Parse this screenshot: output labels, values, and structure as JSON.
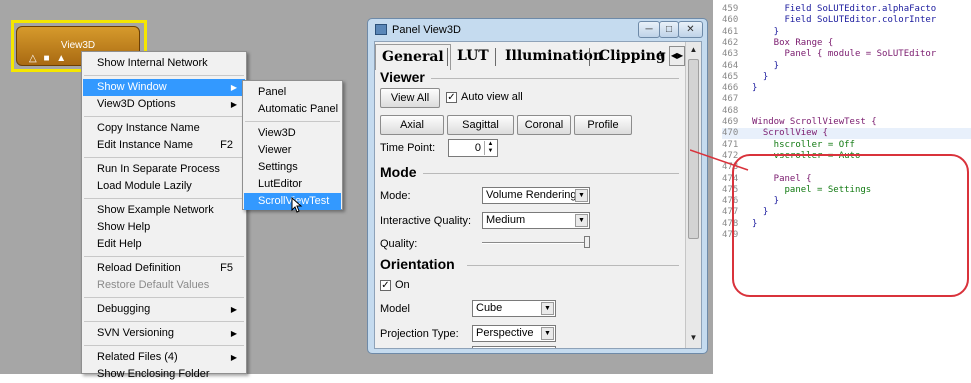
{
  "module": {
    "label": "View3D",
    "ports": "△ ■ ▲"
  },
  "menu": {
    "items": [
      {
        "label": "Show Internal Network",
        "shortcut": "",
        "arrow": false,
        "disabled": false,
        "highlighted": false
      },
      {
        "label": "Show Window",
        "shortcut": "",
        "arrow": true,
        "disabled": false,
        "highlighted": true
      },
      {
        "label": "View3D Options",
        "shortcut": "",
        "arrow": true,
        "disabled": false,
        "highlighted": false
      },
      {
        "label": "Copy Instance Name",
        "shortcut": "",
        "arrow": false,
        "disabled": false,
        "highlighted": false
      },
      {
        "label": "Edit Instance Name",
        "shortcut": "F2",
        "arrow": false,
        "disabled": false,
        "highlighted": false
      },
      {
        "label": "Run In Separate Process",
        "shortcut": "",
        "arrow": false,
        "disabled": false,
        "highlighted": false
      },
      {
        "label": "Load Module Lazily",
        "shortcut": "",
        "arrow": false,
        "disabled": false,
        "highlighted": false
      },
      {
        "label": "Show Example Network",
        "shortcut": "",
        "arrow": false,
        "disabled": false,
        "highlighted": false
      },
      {
        "label": "Show Help",
        "shortcut": "",
        "arrow": false,
        "disabled": false,
        "highlighted": false
      },
      {
        "label": "Edit Help",
        "shortcut": "",
        "arrow": false,
        "disabled": false,
        "highlighted": false
      },
      {
        "label": "Reload Definition",
        "shortcut": "F5",
        "arrow": false,
        "disabled": false,
        "highlighted": false
      },
      {
        "label": "Restore Default Values",
        "shortcut": "",
        "arrow": false,
        "disabled": true,
        "highlighted": false
      },
      {
        "label": "Debugging",
        "shortcut": "",
        "arrow": true,
        "disabled": false,
        "highlighted": false
      },
      {
        "label": "SVN Versioning",
        "shortcut": "",
        "arrow": true,
        "disabled": false,
        "highlighted": false
      },
      {
        "label": "Related Files (4)",
        "shortcut": "",
        "arrow": true,
        "disabled": false,
        "highlighted": false
      },
      {
        "label": "Show Enclosing Folder",
        "shortcut": "",
        "arrow": false,
        "disabled": false,
        "highlighted": false
      }
    ]
  },
  "submenu": {
    "items": [
      {
        "label": "Panel",
        "highlighted": false
      },
      {
        "label": "Automatic Panel",
        "highlighted": false
      },
      {
        "label": "View3D",
        "highlighted": false
      },
      {
        "label": "Viewer",
        "highlighted": false
      },
      {
        "label": "Settings",
        "highlighted": false
      },
      {
        "label": "LutEditor",
        "highlighted": false
      },
      {
        "label": "ScrollViewTest",
        "highlighted": true
      }
    ]
  },
  "panel": {
    "title": "Panel View3D",
    "tabs": [
      "General",
      "LUT",
      "Illumination",
      "Clipping",
      "A"
    ],
    "viewer": {
      "heading": "Viewer",
      "view_all": "View All",
      "auto_view_all": "Auto view all",
      "auto_view_all_checked": true,
      "axial": "Axial",
      "sagittal": "Sagittal",
      "coronal": "Coronal",
      "profile": "Profile",
      "time_point_label": "Time Point:",
      "time_point_value": "0"
    },
    "mode": {
      "heading": "Mode",
      "mode_label": "Mode:",
      "mode_value": "Volume Rendering",
      "quality_label": "Interactive Quality:",
      "quality_value": "Medium",
      "q_label": "Quality:",
      "quality_level": 1.0
    },
    "orientation": {
      "heading": "Orientation",
      "on_label": "On",
      "on_checked": true,
      "model_label": "Model",
      "model_value": "Cube",
      "projection_label": "Projection Type:",
      "projection_value": "Perspective"
    }
  },
  "code": {
    "lines": [
      {
        "n": "459",
        "text": "      Field SoLUTEditor.alphaFacto",
        "kind": "tx"
      },
      {
        "n": "460",
        "text": "      Field SoLUTEditor.colorInter",
        "kind": "tx"
      },
      {
        "n": "461",
        "text": "    }",
        "kind": "tx"
      },
      {
        "n": "462",
        "text": "    Box Range {",
        "kind": "kw"
      },
      {
        "n": "463",
        "text": "      Panel { module = SoLUTEditor",
        "kind": "kw"
      },
      {
        "n": "464",
        "text": "    }",
        "kind": "tx"
      },
      {
        "n": "465",
        "text": "  }",
        "kind": "tx"
      },
      {
        "n": "466",
        "text": "}",
        "kind": "tx"
      },
      {
        "n": "467",
        "text": "",
        "kind": "tx"
      },
      {
        "n": "468",
        "text": "",
        "kind": "tx"
      },
      {
        "n": "469",
        "text": "Window ScrollViewTest {",
        "kind": "kw"
      },
      {
        "n": "470",
        "text": "  ScrollView {",
        "kind": "kw"
      },
      {
        "n": "471",
        "text": "    hscroller = Off",
        "kind": "va"
      },
      {
        "n": "472",
        "text": "    vscroller = Auto",
        "kind": "va"
      },
      {
        "n": "473",
        "text": "",
        "kind": "tx"
      },
      {
        "n": "474",
        "text": "    Panel {",
        "kind": "kw"
      },
      {
        "n": "475",
        "text": "      panel = Settings",
        "kind": "va"
      },
      {
        "n": "476",
        "text": "    }",
        "kind": "tx"
      },
      {
        "n": "477",
        "text": "  }",
        "kind": "tx"
      },
      {
        "n": "478",
        "text": "}",
        "kind": "tx"
      },
      {
        "n": "479",
        "text": "",
        "kind": "tx"
      }
    ],
    "highlight_line": "470"
  },
  "colors": {
    "menu_highlight": "#3399ff",
    "callout": "#d9323b",
    "module_highlight": "#f5e700"
  }
}
